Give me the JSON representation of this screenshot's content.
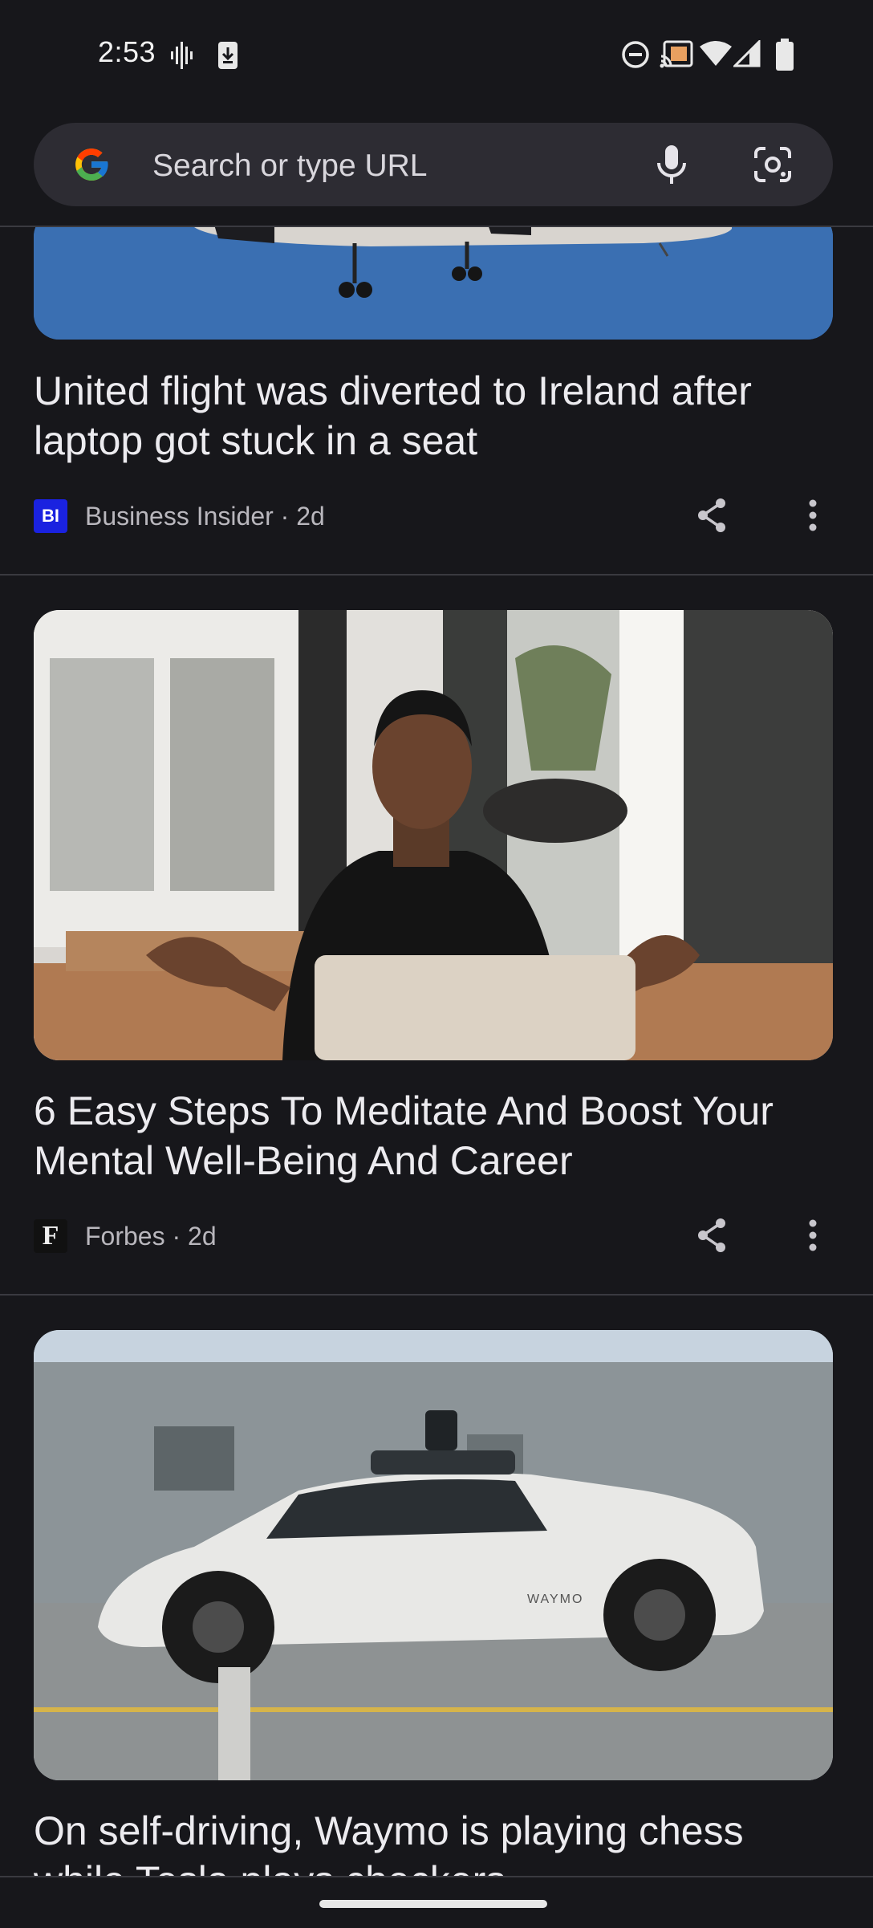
{
  "status_bar": {
    "time": "2:53",
    "left_icons": [
      "voicemail-icon",
      "download-icon"
    ],
    "right_icons": [
      "do-not-disturb-icon",
      "cast-icon",
      "wifi-icon",
      "signal-icon",
      "battery-icon"
    ]
  },
  "search": {
    "placeholder": "Search or type URL",
    "icons": [
      "google-logo-icon",
      "microphone-icon",
      "lens-camera-icon"
    ]
  },
  "articles": [
    {
      "title": "United flight was diverted to Ireland after laptop got stuck in a seat",
      "source_logo": "BI",
      "source": "Business Insider · 2d",
      "image": "airplane"
    },
    {
      "title": "6 Easy Steps To Meditate And Boost Your Mental Well-Being And Career",
      "source_logo": "F",
      "source": "Forbes · 2d",
      "image": "man-meditating-at-laptop"
    },
    {
      "title": "On self-driving, Waymo is playing chess while Tesla plays checkers",
      "image": "waymo-car",
      "car_text": "WAYMO"
    }
  ],
  "colors": {
    "background": "#17171b",
    "search_bar": "#2d2c33",
    "bi_logo": "#1a22e0",
    "sky_blue": "#3d72b4"
  }
}
